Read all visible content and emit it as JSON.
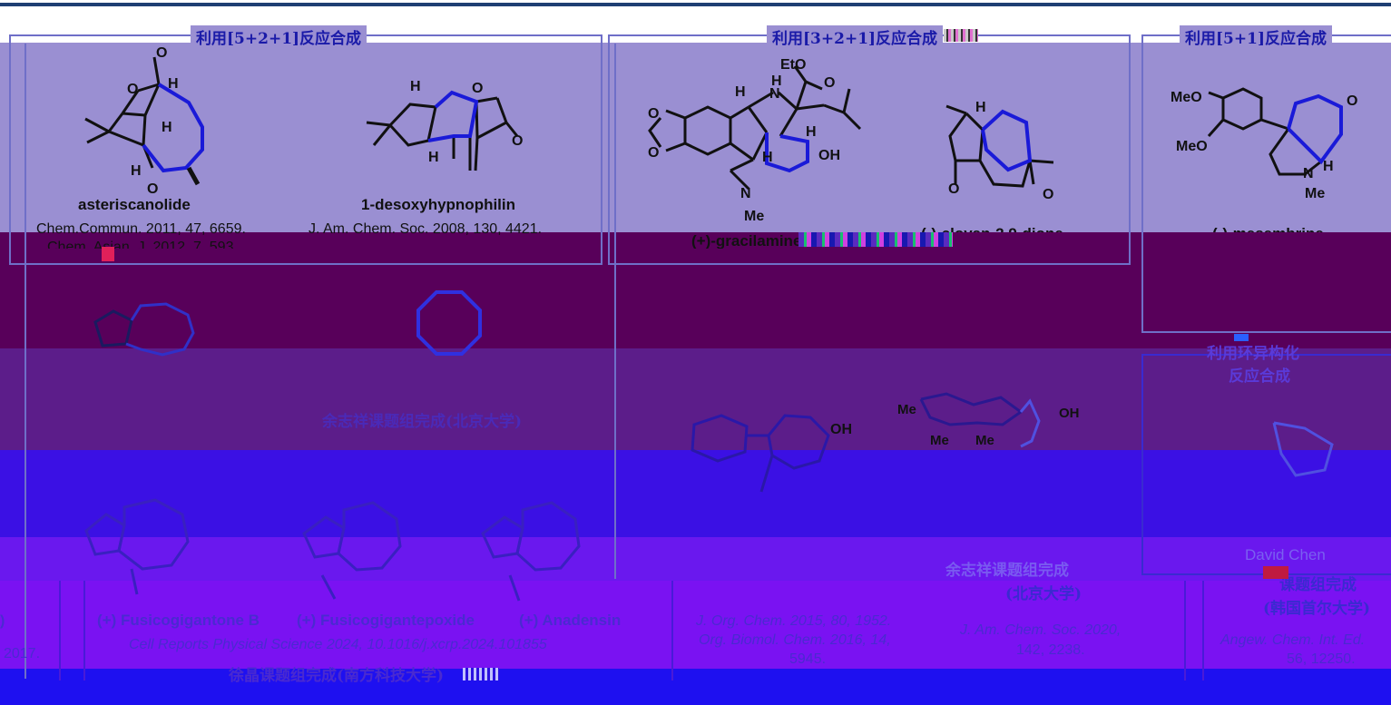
{
  "sections": {
    "top_left_title": "利用[5+2+1]反应合成",
    "top_mid_title": "利用[3+2+1]反应合成",
    "top_right_title": "利用[5+1]反应合成",
    "right_middle_title_line1": "利用环异构化",
    "right_middle_title_line2": "反应合成"
  },
  "compounds": {
    "c1_name": "asteriscanolide",
    "c1_ref1": "Chem.Commun. 2011, 47, 6659.",
    "c1_ref2": "Chem. Asian. J. 2012, 7, 593.",
    "c2_name": "1-desoxyhypnophilin",
    "c2_ref": "J. Am. Chem. Soc. 2008, 130, 4421.",
    "c3_name": "(+)-gracilamine",
    "c4_name": "(-)-clovan-2,9-dione",
    "c5_name": "(-)-mesembrine",
    "f1_name": "(+) Fusicogigantone B",
    "f2_name": "(+) Fusicogigantepoxide",
    "f3_name": "(+) Anadensin"
  },
  "labels": {
    "yu_group": "余志祥课题组完成(北京大学)",
    "mid_group_line1": "余志祥课题组完成",
    "mid_group_line2": "(北京大学)",
    "xu_group": "徐晶课题组完成(南方科技大学)",
    "chen_name": "David Chen",
    "chen_group_line1": "课题组完成",
    "chen_group_line2": "(韩国首尔大学)"
  },
  "refs": {
    "left_year_fragment": "2017.",
    "left_paren_fragment": ")",
    "fusico_ref": "Cell Reports Physical Science 2024, 10.1016/j.xcrp.2024.101855",
    "gracil_ref_line1": "J. Org. Chem. 2015, 80, 1952.",
    "gracil_ref_line2": "Org. Biomol. Chem. 2016, 14,",
    "gracil_ref_line3": "5945.",
    "clovan_ref_line1": "J. Am. Chem. Soc. 2020,",
    "clovan_ref_line2": "142, 2238.",
    "angew_ref_line1": "Angew. Chem. Int. Ed.",
    "angew_ref_line2": "56, 12250."
  },
  "atoms": {
    "O": "O",
    "H": "H",
    "OH": "OH",
    "N": "N",
    "Me": "Me",
    "EtO": "EtO",
    "MeO": "MeO"
  },
  "colors": {
    "top_band": "#9a8fd2",
    "dark_band": "#58005a",
    "purple_band": "#5c1d8a",
    "blue_band": "#3b10e4",
    "violet_band": "#6a18ee",
    "bottom_band": "#7a12f2",
    "bond_blue": "#1a1ad8"
  }
}
